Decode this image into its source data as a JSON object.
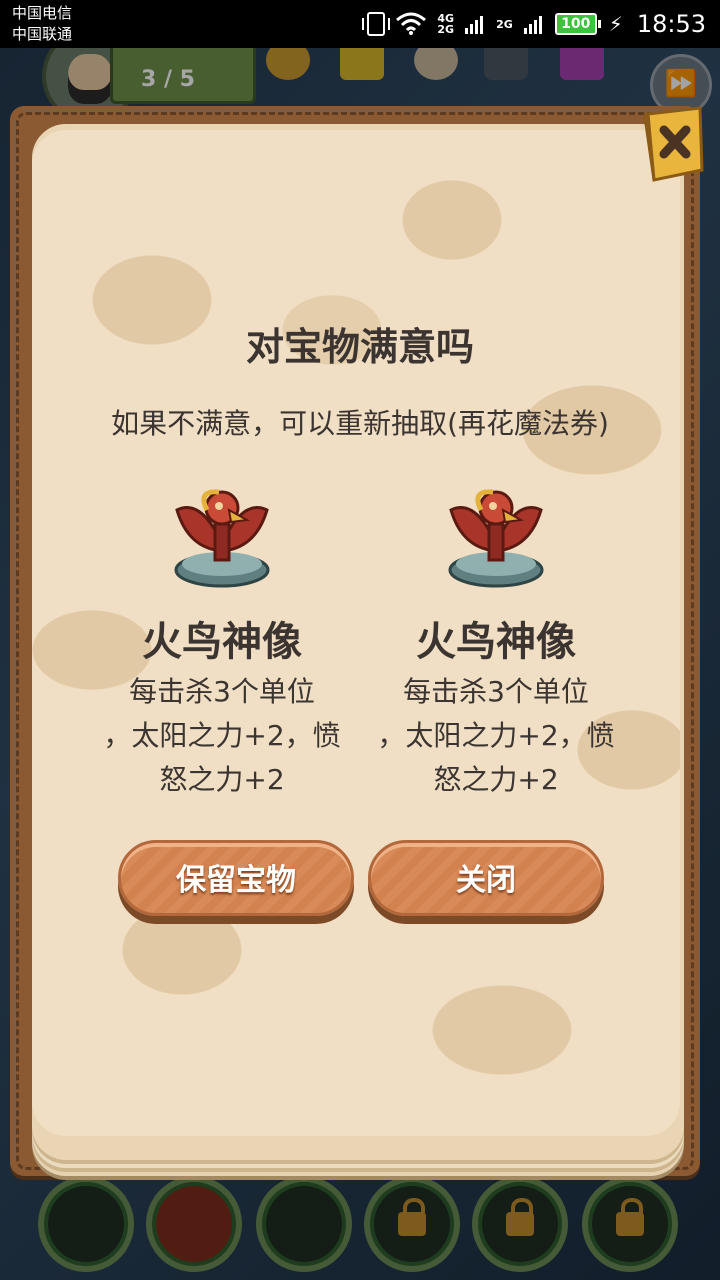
{
  "status_bar": {
    "carrier_1": "中国电信",
    "carrier_2": "中国联通",
    "net_1": "4G",
    "net_1b": "2G",
    "net_2": "2G",
    "battery": "100",
    "time": "18:53"
  },
  "hud": {
    "counter_text": "3 / 5"
  },
  "dialog": {
    "title": "对宝物满意吗",
    "subtitle": "如果不满意，可以重新抽取(再花魔法券)",
    "treasures": [
      {
        "name": "火鸟神像",
        "desc_line_1": "每击杀3个单位",
        "desc_line_2": "，太阳之力+2，愤",
        "desc_line_3": "怒之力+2",
        "icon": "firebird-statue-icon"
      },
      {
        "name": "火鸟神像",
        "desc_line_1": "每击杀3个单位",
        "desc_line_2": "，太阳之力+2，愤",
        "desc_line_3": "怒之力+2",
        "icon": "firebird-statue-icon"
      }
    ],
    "keep_button": "保留宝物",
    "close_button": "关闭"
  },
  "colors": {
    "page": "#f0dfc4",
    "frame": "#8b5a33",
    "button": "#d88a58",
    "text": "#3b3430"
  }
}
